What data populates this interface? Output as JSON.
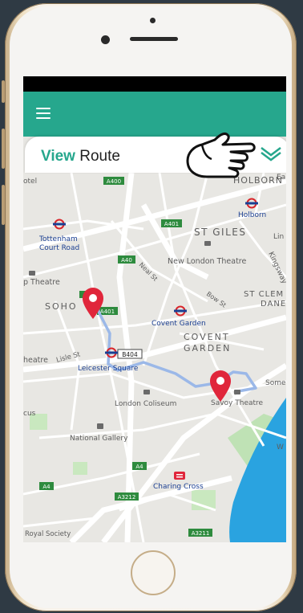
{
  "app": {
    "title_accent": "View",
    "title_rest": " Route"
  },
  "colors": {
    "brand": "#26a78d",
    "pin": "#e0263b",
    "route": "#9bb8e8",
    "water": "#2aa3e0"
  },
  "map": {
    "roads": {
      "a400": "A400",
      "a401": "A401",
      "a40": "A40",
      "a4": "A4",
      "a3212": "A3212",
      "a3211": "A3211",
      "b404": "B404"
    },
    "labels": {
      "holborn_area": "HOLBORN",
      "holborn": "Holborn",
      "st_giles": "ST GILES",
      "tottenham_1": "Tottenham",
      "tottenham_2": "Court Road",
      "new_london_theatre": "New London Theatre",
      "theatre_left": "p Theatre",
      "soho": "SOHO",
      "st_clem_1": "ST CLEM",
      "st_clem_2": "DANE",
      "covent_garden_station": "Covent Garden",
      "covent_1": "COVENT",
      "covent_2": "GARDEN",
      "leicester_square": "Leicester Square",
      "lisle_st": "Lisle St",
      "neal_st": "Neal St",
      "bow_st": "Bow St",
      "kingsway": "Kingsway",
      "theatre_left_2": "heatre",
      "some": "Some",
      "savoy": "Savoy Theatre",
      "coliseum": "London Coliseum",
      "national_gallery": "National Gallery",
      "charing_cross": "Charing Cross",
      "royal_society": "Royal Society",
      "cus": "cus",
      "otel": "otel",
      "ea": "Ea",
      "lin": "Lin",
      "w": "W"
    }
  },
  "icons": {
    "menu": "menu-icon",
    "chevron": "chevron-down-icon",
    "hand": "pointing-hand-icon",
    "pin": "map-pin-icon",
    "station": "underground-icon",
    "rail": "rail-icon",
    "theatre": "theatre-icon"
  }
}
